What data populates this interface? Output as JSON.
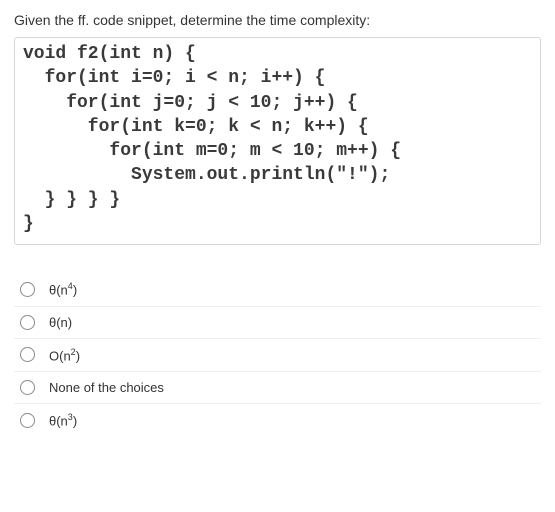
{
  "question": "Given the ff. code snippet, determine the time complexity:",
  "code": {
    "l1": "void f2(int n) {",
    "l2": "  for(int i=0; i < n; i++) {",
    "l3": "    for(int j=0; j < 10; j++) {",
    "l4": "      for(int k=0; k < n; k++) {",
    "l5": "        for(int m=0; m < 10; m++) {",
    "l6": "          System.out.println(\"!\");",
    "l7": "  } } } }",
    "l8": "}"
  },
  "options": [
    {
      "label_html": "θ(n<span class=\"sup\">4</span>)"
    },
    {
      "label_html": "θ(n)"
    },
    {
      "label_html": "O(n<span class=\"sup\">2</span>)"
    },
    {
      "label_html": "None of the choices"
    },
    {
      "label_html": "θ(n<span class=\"sup\">3</span>)"
    }
  ]
}
